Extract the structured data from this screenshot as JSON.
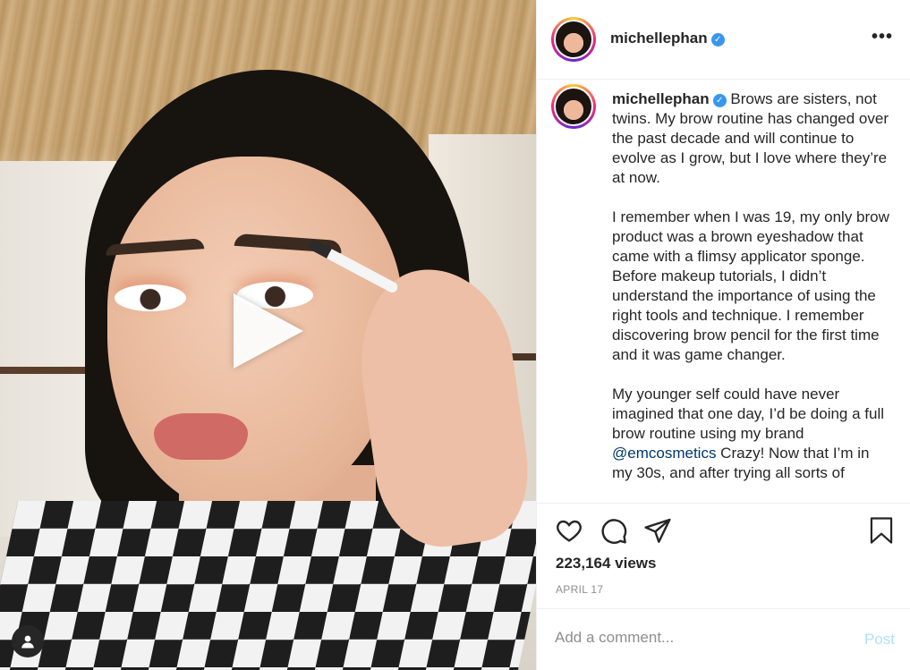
{
  "post": {
    "username": "michellephan",
    "verified_mark": "✓",
    "more_icon": "•••",
    "caption_paragraphs": [
      "Brows are sisters, not twins. My brow routine has changed over the past decade and will continue to evolve as I grow, but I love where they’re at now.",
      "I remember when I was 19, my only brow product was a brown eyeshadow that came with a flimsy applicator sponge. Before makeup tutorials, I didn’t understand the importance of using the right tools and technique. I remember discovering brow pencil for the first time and it was game changer."
    ],
    "caption_p3_before": "My younger self could have never imagined that one day, I’d be doing a full brow routine using my brand ",
    "caption_mention": "@emcosmetics",
    "caption_p3_after": " Crazy! Now that I’m in my 30s, and after trying all sorts of",
    "views": "223,164 views",
    "date": "APRIL 17",
    "comment_placeholder": "Add a comment...",
    "post_label": "Post"
  },
  "icons": {
    "play": "play-icon",
    "user_tag": "user-icon",
    "like": "heart-icon",
    "comment": "comment-icon",
    "share": "share-icon",
    "save": "bookmark-icon"
  },
  "colors": {
    "verified": "#3897f0",
    "mention": "#00376b",
    "post_button": "#b2dffc",
    "muted": "#8e8e8e"
  }
}
